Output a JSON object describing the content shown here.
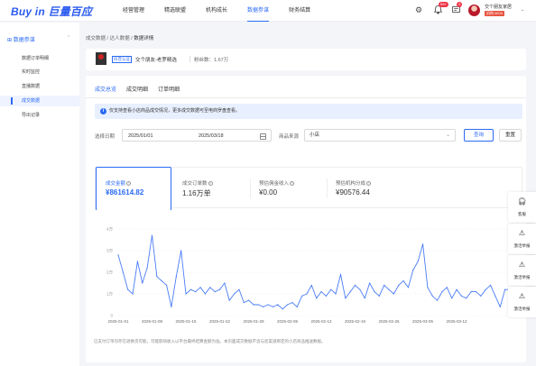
{
  "app": {
    "logo_text": "Buy in 巨量百应",
    "nav": [
      "经营管理",
      "精选联盟",
      "机构成长",
      "数据参谋",
      "财务结算"
    ],
    "active_nav_index": 3,
    "notify_badge": "99+",
    "message_badge": "3",
    "user_name": "交个朋友家居",
    "user_tag": "机构 MCN"
  },
  "sidebar": {
    "section_title": "数据参谋",
    "items": [
      "数据订单明细",
      "实时监控",
      "直播数据",
      "成交数据",
      "导出记录"
    ],
    "active_index": 3
  },
  "breadcrumb": {
    "items": [
      "成交数据",
      "达人数据",
      "数据详情"
    ]
  },
  "shop": {
    "tag": "抖音认证",
    "name": "交个朋友-老罗精选",
    "fans": "粉丝数：1.67万"
  },
  "tabs": {
    "items": [
      "成交总览",
      "成交明细",
      "订单明细"
    ],
    "active_index": 0
  },
  "notice": {
    "text": "仅支持查看小店商品成交情况，更多成交数据可至电商罗盘查看。"
  },
  "filters": {
    "date_label": "选择日期",
    "start_date": "2025/01/01",
    "end_date": "2025/03/18",
    "source_label": "商品来源",
    "source_value": "小店",
    "query_button": "查询",
    "reset_button": "重置"
  },
  "metrics": [
    {
      "label": "成交金额",
      "value": "¥861614.82"
    },
    {
      "label": "成交订单数",
      "value": "1.16万单"
    },
    {
      "label": "预估佣金收入",
      "value": "¥0.00"
    },
    {
      "label": "预估机构分成",
      "value": "¥90576.44"
    }
  ],
  "active_metric_index": 0,
  "chart_data": {
    "type": "line",
    "title": "",
    "xlabel": "",
    "ylabel": "",
    "yticks": [
      "4万",
      "3万",
      "2万",
      "1万",
      "0"
    ],
    "ylim": [
      0,
      40000
    ],
    "grid": true,
    "color": "#4a7cf7",
    "xtick_labels": [
      "2025-01-01",
      "2025-01-08",
      "2025-01-15",
      "2025-01-22",
      "2025-01-29",
      "2025-02-05",
      "2025-02-12",
      "2025-02-19",
      "2025-02-26",
      "2025-03-05",
      "2025-03-12"
    ],
    "values": [
      28000,
      20000,
      12000,
      10000,
      25000,
      15000,
      22000,
      37000,
      18000,
      16000,
      14000,
      4000,
      18000,
      30000,
      10000,
      12000,
      11000,
      13000,
      10000,
      13000,
      11000,
      12000,
      15000,
      7000,
      10000,
      12000,
      6000,
      7000,
      5000,
      5000,
      4000,
      5000,
      4000,
      5000,
      3000,
      5000,
      6000,
      4000,
      9000,
      10000,
      14000,
      8000,
      11000,
      9000,
      12000,
      10000,
      19000,
      8000,
      11000,
      14000,
      12000,
      8000,
      15000,
      11000,
      9000,
      14000,
      12000,
      10000,
      14000,
      16000,
      13000,
      21000,
      25000,
      33000,
      13000,
      9000,
      7000,
      11000,
      13000,
      8000,
      12000,
      9000,
      8000,
      11000,
      11000,
      9000,
      12000,
      14000,
      9000,
      4000,
      12000,
      12000
    ]
  },
  "footnote": "已支付订单均存在退换货可能，可能影响收入以平台最终结算金额为准。本页面成交数据不含与您渠道绑定的小店商品推送数据。",
  "float_tools": [
    {
      "icon": "headset-icon",
      "label": "客服"
    },
    {
      "icon": "warning-icon",
      "label": "激活举报"
    },
    {
      "icon": "warning-icon",
      "label": "激活举报"
    },
    {
      "icon": "warning-icon",
      "label": "激活举报"
    }
  ]
}
